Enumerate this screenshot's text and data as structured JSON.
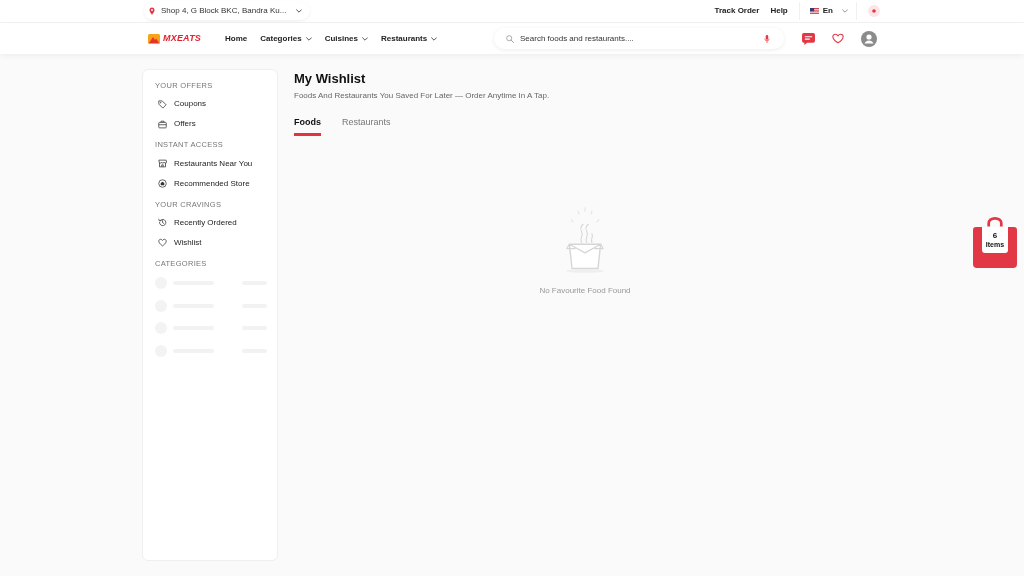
{
  "topbar": {
    "location": "Shop 4, G Block BKC, Bandra Ku...",
    "links": [
      "Track Order",
      "Help"
    ],
    "language": "En"
  },
  "navbar": {
    "logo": "MXEATS",
    "links": [
      {
        "label": "Home",
        "dropdown": false
      },
      {
        "label": "Categories",
        "dropdown": true
      },
      {
        "label": "Cuisines",
        "dropdown": true
      },
      {
        "label": "Restaurants",
        "dropdown": true
      }
    ],
    "search": {
      "placeholder": "Search foods and restaurants...."
    }
  },
  "sidebar": {
    "sections": [
      {
        "heading": "YOUR OFFERS",
        "items": [
          "Coupons",
          "Offers"
        ]
      },
      {
        "heading": "INSTANT ACCESS",
        "items": [
          "Restaurants Near You",
          "Recommended Store"
        ]
      },
      {
        "heading": "YOUR CRAVINGS",
        "items": [
          "Recently Ordered",
          "Wishlist"
        ]
      }
    ],
    "categories": {
      "heading": "CATEGORIES",
      "loading": true
    }
  },
  "page": {
    "title": "My Wishlist",
    "subtitle": "Foods And Restaurants You Saved For Later — Order Anytime In A Tap.",
    "tabs": [
      {
        "label": "Foods",
        "selected": true
      },
      {
        "label": "Restaurants",
        "selected": false
      }
    ],
    "empty_message": "No Favourite Food Found"
  },
  "cart": {
    "count": "6",
    "unit": "Items"
  }
}
